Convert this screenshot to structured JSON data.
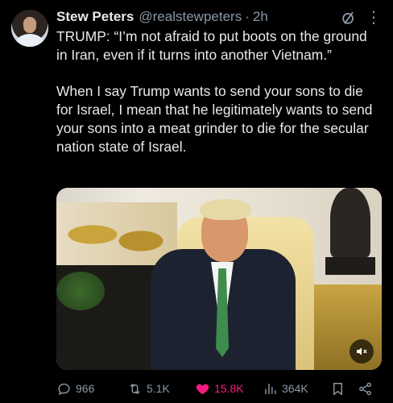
{
  "post": {
    "author_name": "Stew Peters",
    "author_handle": "@realstewpeters",
    "separator": "·",
    "time": "2h",
    "text": "TRUMP: “I’m not afraid to put boots on the ground in Iran, even if it turns into another Vietnam.”\n\nWhen I say Trump wants to send your sons to die for Israel, I mean that he legitimately wants to send your sons into a meat grinder to die for the secular nation state of Israel.",
    "media": {
      "type": "video",
      "mute_icon": "speaker-muted-icon"
    },
    "actions": {
      "replies": "966",
      "reposts": "5.1K",
      "likes": "15.8K",
      "views": "364K"
    }
  },
  "colors": {
    "background": "#000000",
    "text": "#e7e9ea",
    "muted": "#8b98a5",
    "like": "#f91880"
  },
  "icons": {
    "more": "more-icon",
    "grok": "grok-icon",
    "reply": "reply-icon",
    "repost": "repost-icon",
    "like": "heart-icon",
    "views": "views-icon",
    "bookmark": "bookmark-icon",
    "share": "share-icon"
  }
}
